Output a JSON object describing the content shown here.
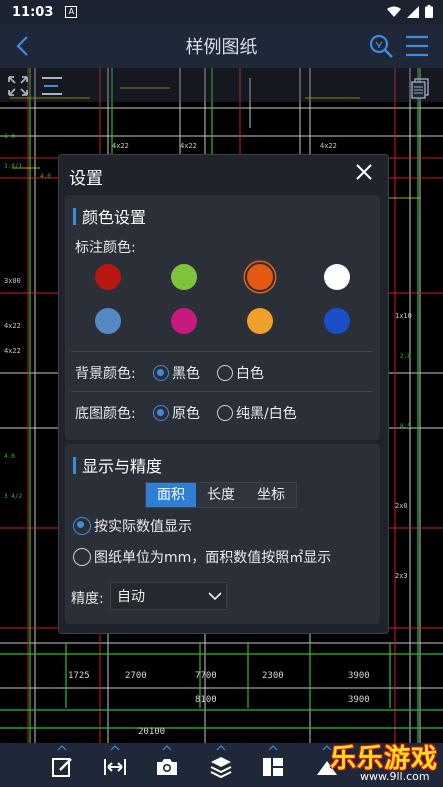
{
  "status": {
    "time": "11:03",
    "notif_icon": "A"
  },
  "appbar": {
    "title": "样例图纸"
  },
  "panel": {
    "title": "设置",
    "color_section": {
      "title": "颜色设置",
      "annot_label": "标注颜色:",
      "swatches": [
        {
          "name": "red",
          "color": "#b8170f"
        },
        {
          "name": "green",
          "color": "#7ec43a"
        },
        {
          "name": "orange",
          "color": "#e55a10",
          "selected": true
        },
        {
          "name": "white",
          "color": "#ffffff"
        },
        {
          "name": "blue",
          "color": "#5589c4"
        },
        {
          "name": "magenta",
          "color": "#c71a7e"
        },
        {
          "name": "amber",
          "color": "#eea12a"
        },
        {
          "name": "navy",
          "color": "#1a4fc7"
        }
      ],
      "bg_label": "背景颜色:",
      "bg_options": [
        {
          "label": "黑色",
          "checked": true
        },
        {
          "label": "白色",
          "checked": false
        }
      ],
      "base_label": "底图颜色:",
      "base_options": [
        {
          "label": "原色",
          "checked": true
        },
        {
          "label": "纯黑/白色",
          "checked": false
        }
      ]
    },
    "display_section": {
      "title": "显示与精度",
      "tabs": [
        {
          "label": "面积",
          "active": true
        },
        {
          "label": "长度",
          "active": false
        },
        {
          "label": "坐标",
          "active": false
        }
      ],
      "options": [
        {
          "label": "按实际数值显示",
          "checked": true
        },
        {
          "label": "图纸单位为mm，面积数值按照㎡显示",
          "checked": false
        }
      ],
      "precision_label": "精度:",
      "precision_value": "自动"
    }
  },
  "drawing": {
    "labels": [
      "1725",
      "2700",
      "7700",
      "2300",
      "3900",
      "8100",
      "3900",
      "20100"
    ]
  },
  "watermark": {
    "text": "乐乐游戏",
    "url": "www.9ll.com"
  }
}
